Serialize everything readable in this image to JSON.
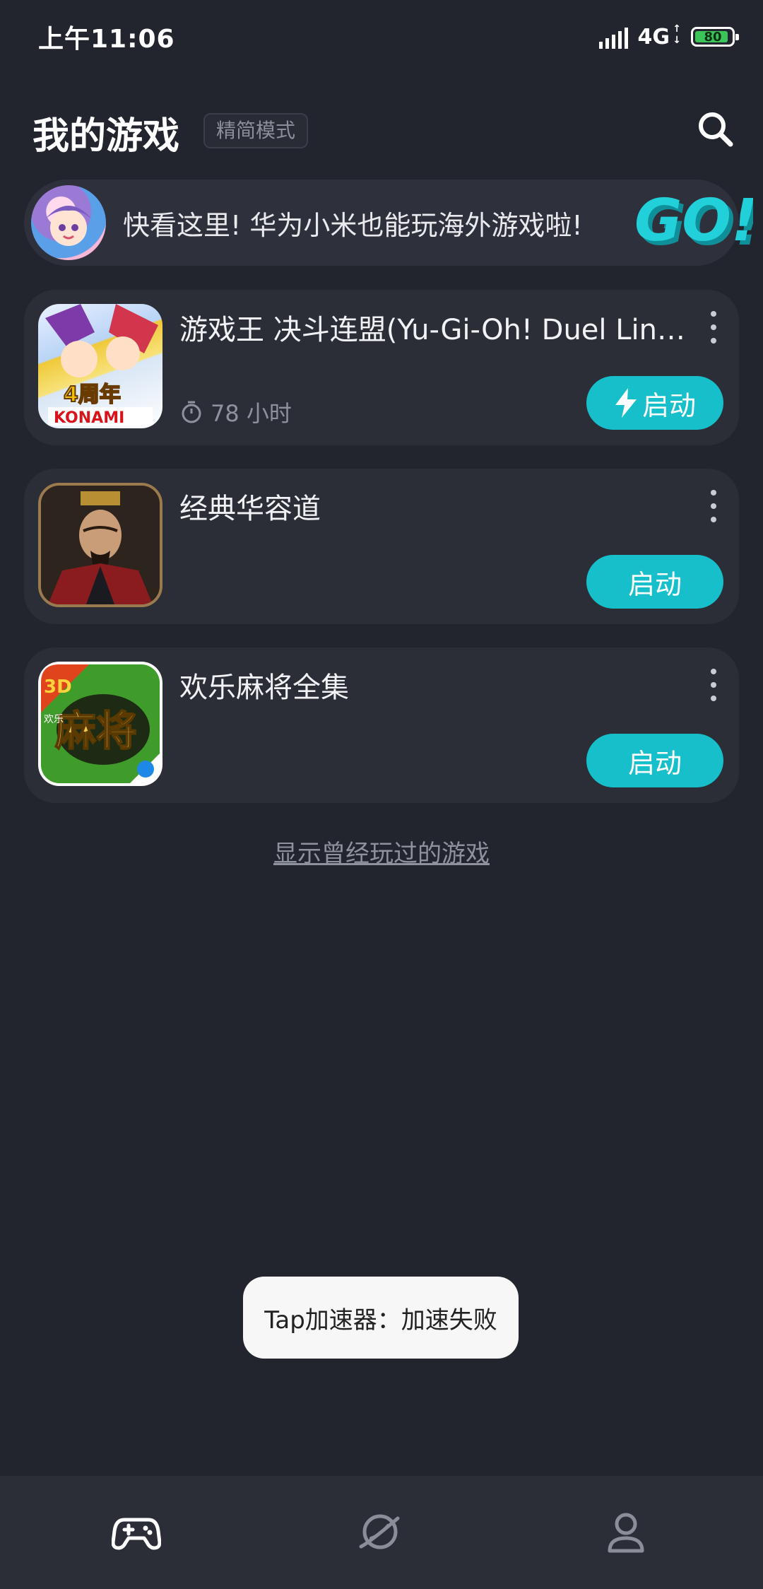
{
  "status_bar": {
    "time": "上午11:06",
    "network": "4G",
    "battery": "80"
  },
  "header": {
    "title": "我的游戏",
    "mode_badge": "精简模式",
    "search_icon": "search-icon"
  },
  "promo": {
    "text": "快看这里! 华为小米也能玩海外游戏啦!",
    "go_text": "GO!"
  },
  "games": [
    {
      "title": "游戏王 决斗连盟(Yu-Gi-Oh! Duel Links)",
      "playtime": "78 小时",
      "launch_label": "启动",
      "boost_icon": true,
      "icon_text_top": "4周年",
      "icon_text_bottom": "KONAMI"
    },
    {
      "title": "经典华容道",
      "launch_label": "启动"
    },
    {
      "title": "欢乐麻将全集",
      "launch_label": "启动",
      "icon_text_3d": "3D",
      "icon_text_main": "麻将",
      "icon_text_side": "欢乐"
    }
  ],
  "show_played_label": "显示曾经玩过的游戏",
  "toast": "Tap加速器：加速失败",
  "nav": [
    {
      "icon": "gamepad-icon",
      "active": true
    },
    {
      "icon": "planet-icon",
      "active": false
    },
    {
      "icon": "user-icon",
      "active": false
    }
  ],
  "colors": {
    "background": "#22252e",
    "card": "#2b2e37",
    "accent": "#17bfca"
  }
}
